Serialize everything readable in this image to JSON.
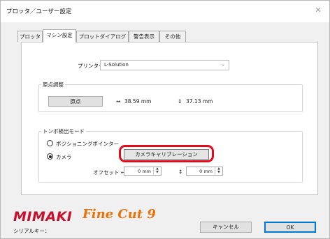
{
  "window": {
    "title": "プロッタ／ユーザー設定",
    "close_glyph": "✕"
  },
  "tabs": [
    "プロッタ",
    "マシン設定",
    "プロットダイアログ",
    "警告表示",
    "その他"
  ],
  "selected_tab": "マシン設定",
  "printer": {
    "label": "プリンター:",
    "value": "L-Solution",
    "arrow": "⌄"
  },
  "origin": {
    "group_title": "原点調整",
    "button": "原点",
    "h_icon": "↔",
    "h_value": "38.59 mm",
    "v_icon": "↕",
    "v_value": "37.13 mm"
  },
  "register": {
    "group_title": "トンボ検出モード",
    "option_pointer": "ポジショニングポインター",
    "option_camera": "カメラ",
    "selected": "カメラ",
    "calibration_button": "カメラキャリブレーション",
    "offset_label": "オフセット ↔",
    "v_icon": "↕",
    "offset_x": "0 mm",
    "offset_y": "0 mm",
    "spin_up": "▲",
    "spin_down": "▼"
  },
  "footer": {
    "logo_mimaki": "MIMAKI",
    "logo_finecut": "Fine Cut 9",
    "serial_label": "シリアルキー：",
    "cancel": "キャンセル",
    "ok": "OK"
  },
  "colors": {
    "highlight": "#e20b1a",
    "mimaki_red": "#c8102e",
    "finecut_orange": "#e8730c",
    "ok_border": "#0078d7"
  }
}
